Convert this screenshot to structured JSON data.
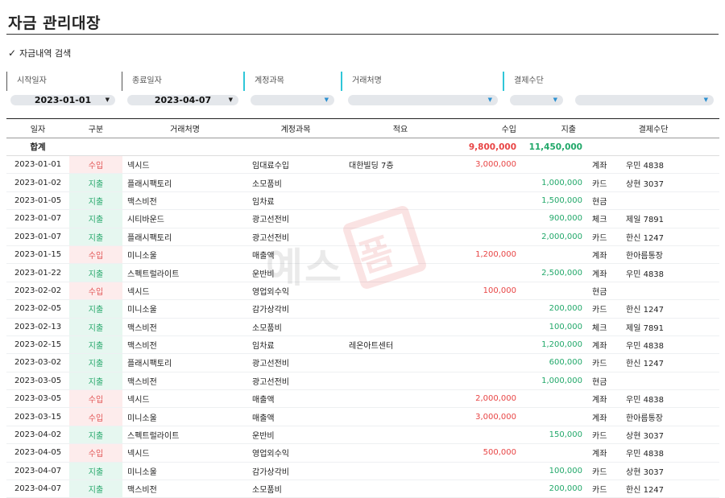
{
  "page": {
    "title": "자금 관리대장"
  },
  "search": {
    "section_label": "자금내역 검색"
  },
  "filters": {
    "start_label": "시작일자",
    "start_value": "2023-01-01",
    "end_label": "종료일자",
    "end_value": "2023-04-07",
    "account_label": "계정과목",
    "account_value": "",
    "vendor_label": "거래처명",
    "vendor_value": "",
    "payment_label": "결제수단",
    "payment_type_value": "",
    "payment_detail_value": ""
  },
  "table": {
    "headers": [
      "일자",
      "구분",
      "거래처명",
      "계정과목",
      "적요",
      "수입",
      "지출",
      "결제수단"
    ],
    "summary": {
      "label": "합계",
      "income": "9,800,000",
      "expense": "11,450,000"
    },
    "rows": [
      {
        "date": "2023-01-01",
        "type": "수입",
        "vendor": "넥시드",
        "account": "임대료수입",
        "memo": "대한빌딩 7층",
        "income": "3,000,000",
        "expense": "",
        "method": "계좌",
        "detail": "우민 4838"
      },
      {
        "date": "2023-01-02",
        "type": "지출",
        "vendor": "플래시팩토리",
        "account": "소모품비",
        "memo": "",
        "income": "",
        "expense": "1,000,000",
        "method": "카드",
        "detail": "상현 3037"
      },
      {
        "date": "2023-01-05",
        "type": "지출",
        "vendor": "맥스비전",
        "account": "임차료",
        "memo": "",
        "income": "",
        "expense": "1,500,000",
        "method": "현금",
        "detail": ""
      },
      {
        "date": "2023-01-07",
        "type": "지출",
        "vendor": "시티바운드",
        "account": "광고선전비",
        "memo": "",
        "income": "",
        "expense": "900,000",
        "method": "체크",
        "detail": "제일 7891"
      },
      {
        "date": "2023-01-07",
        "type": "지출",
        "vendor": "플래시팩토리",
        "account": "광고선전비",
        "memo": "",
        "income": "",
        "expense": "2,000,000",
        "method": "카드",
        "detail": "한신 1247"
      },
      {
        "date": "2023-01-15",
        "type": "수입",
        "vendor": "미니소울",
        "account": "매출액",
        "memo": "",
        "income": "1,200,000",
        "expense": "",
        "method": "계좌",
        "detail": "한아름통장"
      },
      {
        "date": "2023-01-22",
        "type": "지출",
        "vendor": "스펙트럴라이트",
        "account": "운반비",
        "memo": "",
        "income": "",
        "expense": "2,500,000",
        "method": "계좌",
        "detail": "우민 4838"
      },
      {
        "date": "2023-02-02",
        "type": "수입",
        "vendor": "넥시드",
        "account": "영업외수익",
        "memo": "",
        "income": "100,000",
        "expense": "",
        "method": "현금",
        "detail": ""
      },
      {
        "date": "2023-02-05",
        "type": "지출",
        "vendor": "미니소울",
        "account": "감가상각비",
        "memo": "",
        "income": "",
        "expense": "200,000",
        "method": "카드",
        "detail": "한신 1247"
      },
      {
        "date": "2023-02-13",
        "type": "지출",
        "vendor": "맥스비전",
        "account": "소모품비",
        "memo": "",
        "income": "",
        "expense": "100,000",
        "method": "체크",
        "detail": "제일 7891"
      },
      {
        "date": "2023-02-15",
        "type": "지출",
        "vendor": "맥스비전",
        "account": "임차료",
        "memo": "레온아트센터",
        "income": "",
        "expense": "1,200,000",
        "method": "계좌",
        "detail": "우민 4838"
      },
      {
        "date": "2023-03-02",
        "type": "지출",
        "vendor": "플래시팩토리",
        "account": "광고선전비",
        "memo": "",
        "income": "",
        "expense": "600,000",
        "method": "카드",
        "detail": "한신 1247"
      },
      {
        "date": "2023-03-05",
        "type": "지출",
        "vendor": "맥스비전",
        "account": "광고선전비",
        "memo": "",
        "income": "",
        "expense": "1,000,000",
        "method": "현금",
        "detail": ""
      },
      {
        "date": "2023-03-05",
        "type": "수입",
        "vendor": "넥시드",
        "account": "매출액",
        "memo": "",
        "income": "2,000,000",
        "expense": "",
        "method": "계좌",
        "detail": "우민 4838"
      },
      {
        "date": "2023-03-15",
        "type": "수입",
        "vendor": "미니소울",
        "account": "매출액",
        "memo": "",
        "income": "3,000,000",
        "expense": "",
        "method": "계좌",
        "detail": "한아름통장"
      },
      {
        "date": "2023-04-02",
        "type": "지출",
        "vendor": "스펙트럴라이트",
        "account": "운반비",
        "memo": "",
        "income": "",
        "expense": "150,000",
        "method": "카드",
        "detail": "상현 3037"
      },
      {
        "date": "2023-04-05",
        "type": "수입",
        "vendor": "넥시드",
        "account": "영업외수익",
        "memo": "",
        "income": "500,000",
        "expense": "",
        "method": "계좌",
        "detail": "우민 4838"
      },
      {
        "date": "2023-04-07",
        "type": "지출",
        "vendor": "미니소울",
        "account": "감가상각비",
        "memo": "",
        "income": "",
        "expense": "100,000",
        "method": "카드",
        "detail": "상현 3037"
      },
      {
        "date": "2023-04-07",
        "type": "지출",
        "vendor": "맥스비전",
        "account": "소모품비",
        "memo": "",
        "income": "",
        "expense": "200,000",
        "method": "카드",
        "detail": "한신 1247"
      }
    ]
  },
  "watermark": {
    "text": "예스폼",
    "part_gray": "예스",
    "part_boxed": "폼"
  },
  "icons": {
    "section": "check-icon",
    "dropdown": "triangle-down-icon"
  },
  "colors": {
    "income": "#e84545",
    "expense": "#22a86a",
    "income_bg": "#fdecec",
    "expense_bg": "#e6f7f0",
    "filter_accent": "#2fc6d8"
  }
}
